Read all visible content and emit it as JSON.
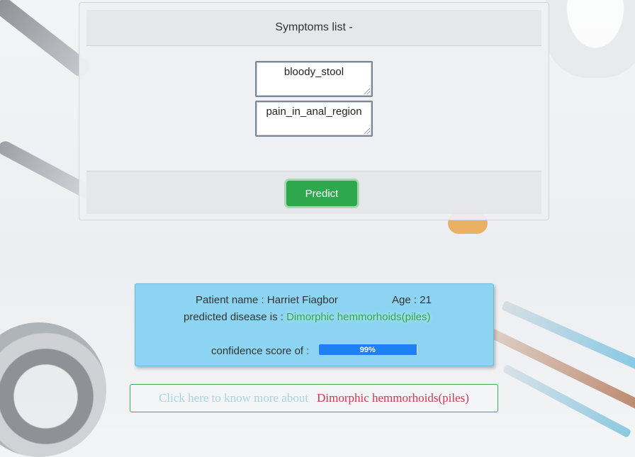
{
  "symptoms_card": {
    "header": "Symptoms list -",
    "symptoms": [
      "bloody_stool",
      "pain_in_anal_region"
    ],
    "predict_label": "Predict"
  },
  "result": {
    "patient_label": "Patient name : Harriet Fiagbor",
    "age_label": "Age : 21",
    "predicted_prefix": "predicted disease is :",
    "disease": "Dimorphic hemmorhoids(piles)",
    "confidence_label": "confidence score of :",
    "confidence_value": 0.99,
    "confidence_text": "99%"
  },
  "more_info": {
    "lead": "Click here to know more about",
    "disease": "Dimorphic hemmorhoids(piles)"
  },
  "colors": {
    "predict_button": "#2fa84d",
    "result_bg": "#8dd4f3",
    "progress_fill": "#1f80f5",
    "disease_text": "#2fa84d",
    "link_disease": "#d4364f"
  }
}
